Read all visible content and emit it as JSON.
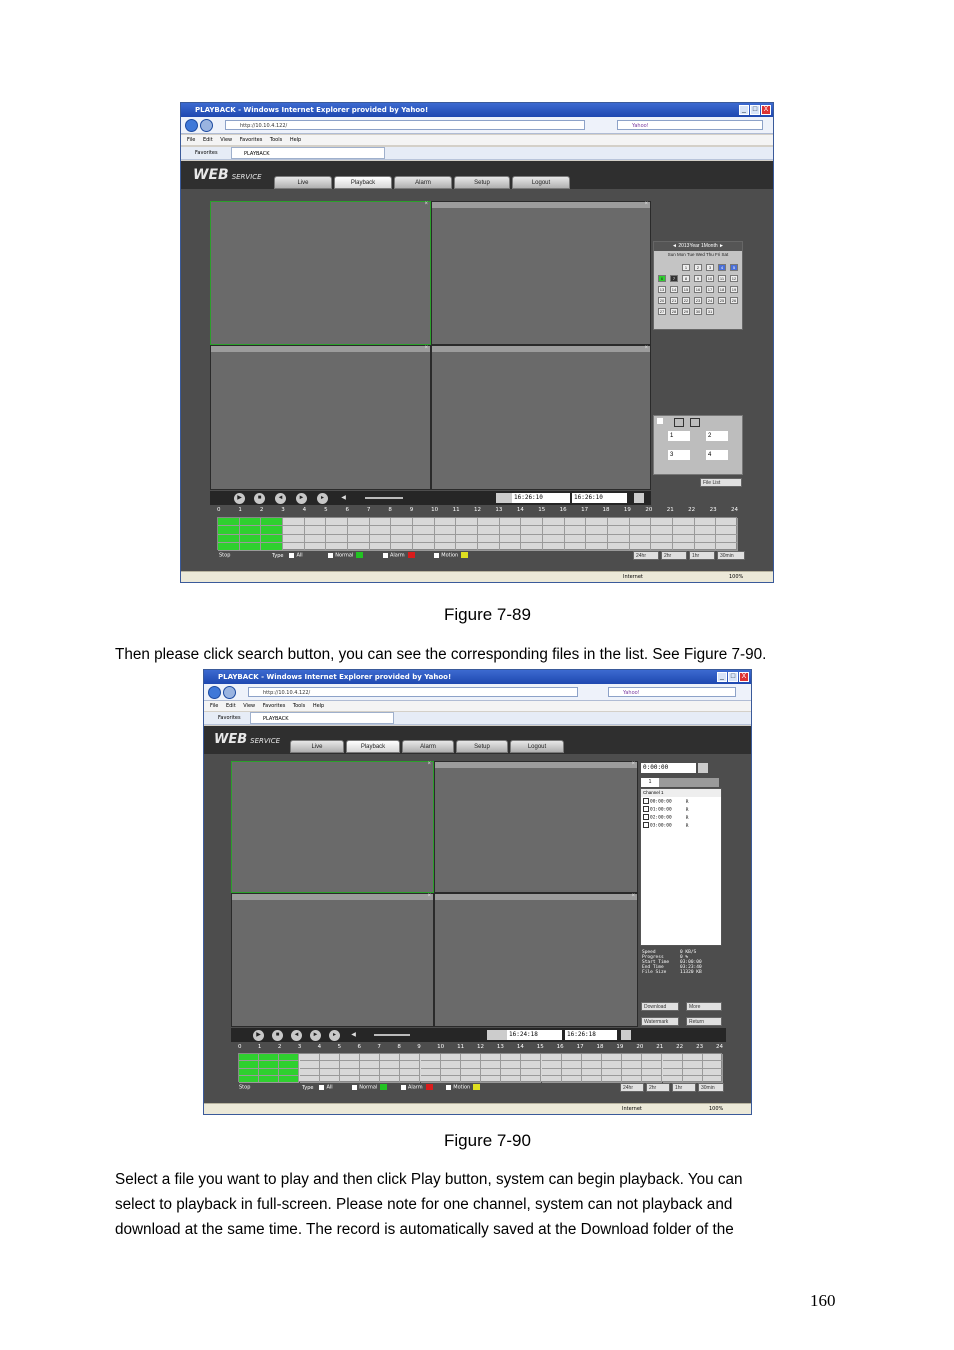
{
  "browser": {
    "window_title": "PLAYBACK - Windows Internet Explorer provided by Yahoo!",
    "url": "http://10.10.4.122/",
    "search_placeholder": "Yahoo!",
    "menu": [
      "File",
      "Edit",
      "View",
      "Favorites",
      "Tools",
      "Help"
    ],
    "favorites_label": "Favorites",
    "tab_title": "PLAYBACK",
    "status_zone": "Internet",
    "zoom": "100%",
    "minimize": "_",
    "maximize": "□",
    "close": "X"
  },
  "app": {
    "brand": "WEB",
    "brand_sub": "SERVICE",
    "tabs": [
      "Live",
      "Playback",
      "Alarm",
      "Setup",
      "Logout"
    ],
    "active_tab": "Playback"
  },
  "calendar": {
    "header": "2013Year 1Month",
    "weekdays": "Sun Mon Tue Wed Thu Fri Sat",
    "days": [
      "1",
      "2",
      "3",
      "4",
      "5",
      "6",
      "7",
      "8",
      "9",
      "10",
      "11",
      "12",
      "13",
      "14",
      "15",
      "16",
      "17",
      "18",
      "19",
      "20",
      "21",
      "22",
      "23",
      "24",
      "25",
      "26",
      "27",
      "28",
      "29",
      "30",
      "31"
    ],
    "first_weekday": 2,
    "today": "6",
    "selected": [
      "4",
      "5"
    ],
    "recorded": [
      "7"
    ]
  },
  "channels": {
    "sel_a": "1",
    "sel_b": "2",
    "sel_c": "3",
    "sel_d": "4",
    "file_list_btn": "File List"
  },
  "timebar": {
    "time_start": "16:26:10",
    "time_end": "16:26:10",
    "time_start_2": "16:24:18",
    "time_end_2": "16:26:18",
    "hours": [
      "0",
      "1",
      "2",
      "3",
      "4",
      "5",
      "6",
      "7",
      "8",
      "9",
      "10",
      "11",
      "12",
      "13",
      "14",
      "15",
      "16",
      "17",
      "18",
      "19",
      "20",
      "21",
      "22",
      "23",
      "24"
    ]
  },
  "legend": {
    "stop": "Stop",
    "type": "Type",
    "all": "All",
    "normal": "Normal",
    "alarm": "Alarm",
    "motion": "Motion",
    "normal_color": "#22c322",
    "alarm_color": "#d91c1c",
    "motion_color": "#e0e020",
    "zoom_buttons": [
      "24hr",
      "2hr",
      "1hr",
      "30min"
    ]
  },
  "search_panel": {
    "search_time": "0:00:00",
    "channel_tab": "1",
    "channel_title": "Channel 1",
    "files": [
      {
        "time": "00:00:00",
        "type": "R"
      },
      {
        "time": "01:00:00",
        "type": "R"
      },
      {
        "time": "02:00:00",
        "type": "R"
      },
      {
        "time": "03:00:00",
        "type": "R"
      }
    ],
    "info_labels": [
      "Speed",
      "Progress",
      "Start Time",
      "End Time",
      "File Size"
    ],
    "info_values": [
      "0 KB/S",
      "0 %",
      "03:00:00",
      "03:23:40",
      "11320 KB"
    ],
    "buttons": [
      "Download",
      "More",
      "Watermark",
      "Return"
    ]
  },
  "document": {
    "caption_1": "Figure 7-89",
    "paragraph_1": "Then please click search button, you can see the corresponding files in the list. See Figure 7-90.",
    "caption_2": "Figure 7-90",
    "paragraph_2": [
      "Select a file you want to play and then click Play button, system can begin playback. You can",
      "select to playback in full-screen. Please note for one channel, system can not playback and",
      "download at the same time. The record is automatically saved at the Download folder of the"
    ],
    "page_number": "160"
  }
}
